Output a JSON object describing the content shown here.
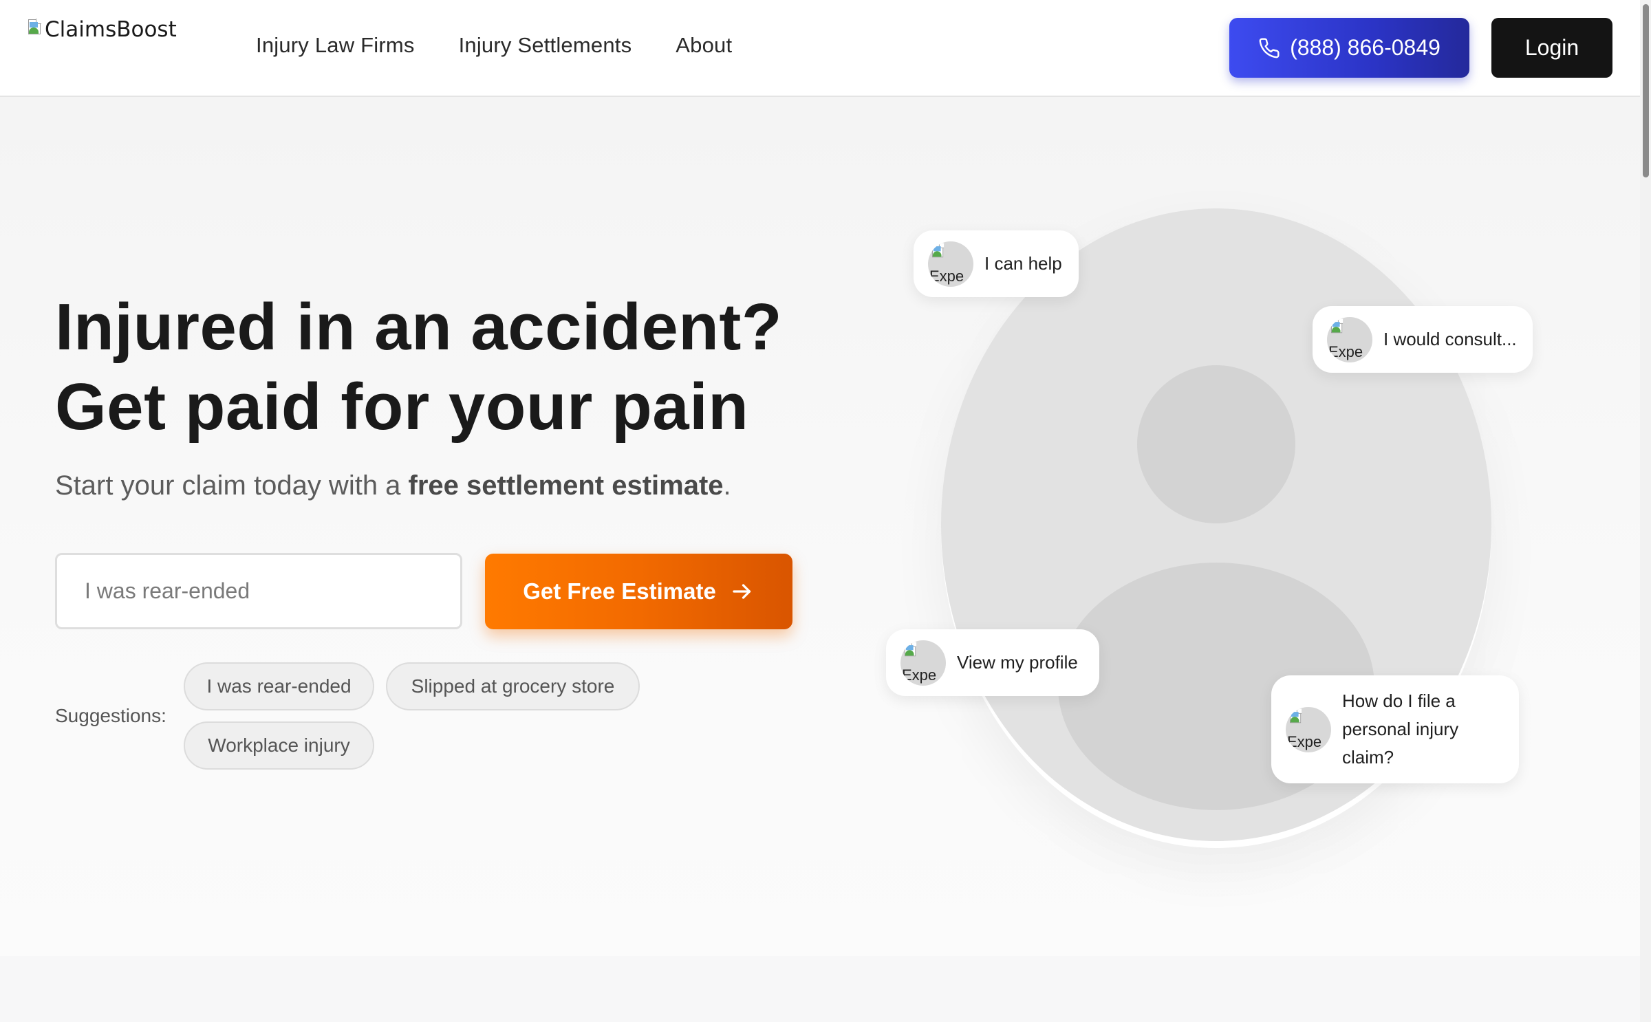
{
  "header": {
    "logo_alt": "ClaimsBoost",
    "nav": [
      {
        "label": "Injury Law Firms"
      },
      {
        "label": "Injury Settlements"
      },
      {
        "label": "About"
      }
    ],
    "phone_label": "(888) 866-0849",
    "login_label": "Login"
  },
  "hero": {
    "headline_line1": "Injured in an accident?",
    "headline_line2": "Get paid for your pain",
    "subline_prefix": "Start your claim today with a ",
    "subline_bold": "free settlement estimate",
    "subline_suffix": ".",
    "input_placeholder": "I was rear-ended",
    "cta_label": "Get Free Estimate",
    "suggestions_label": "Suggestions:",
    "suggestions": [
      {
        "label": "I was rear-ended"
      },
      {
        "label": "Slipped at grocery store"
      },
      {
        "label": "Workplace injury"
      }
    ]
  },
  "bubbles": [
    {
      "text": "I can help",
      "avatar_alt": "Expe"
    },
    {
      "text": "I would consult...",
      "avatar_alt": "Expe"
    },
    {
      "text": "View my profile",
      "avatar_alt": "Expe"
    },
    {
      "text": "How do I file a personal injury claim?",
      "avatar_alt": "Expe"
    }
  ],
  "colors": {
    "phone_button": "#3d4bf0",
    "login_button": "#141414",
    "cta_button": "#ff7a00"
  },
  "icons": {
    "phone": "phone-icon",
    "arrow": "arrow-right-icon"
  }
}
